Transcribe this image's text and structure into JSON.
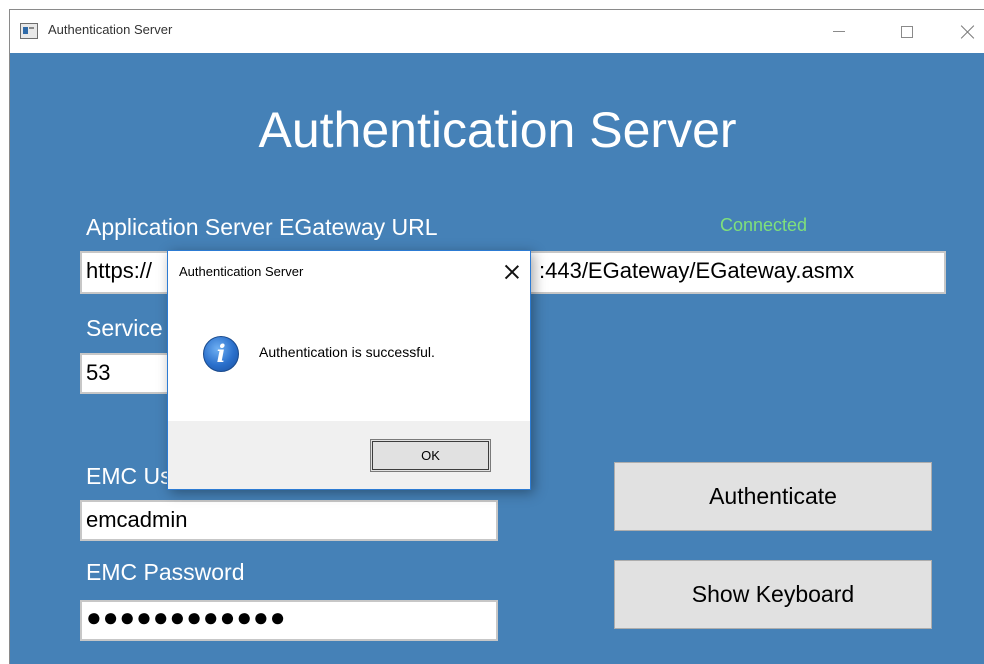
{
  "window": {
    "title": "Authentication Server",
    "controls": {
      "minimize": "minimize-icon",
      "maximize": "maximize-icon",
      "close": "close-icon"
    }
  },
  "main": {
    "heading": "Authentication Server",
    "url_label": "Application Server EGateway URL",
    "status": "Connected",
    "url_value": "https://",
    "url_value_suffix": ":443/EGateway/EGateway.asmx",
    "service_label": "Service",
    "service_value": "53",
    "user_label": "EMC Us",
    "user_value": "emcadmin",
    "password_label": "EMC Password",
    "password_value": "●●●●●●●●●●●●",
    "authenticate_button": "Authenticate",
    "keyboard_button": "Show Keyboard"
  },
  "dialog": {
    "title": "Authentication Server",
    "message": "Authentication is successful.",
    "icon": "info-icon",
    "ok_label": "OK"
  },
  "colors": {
    "background": "#4581b7",
    "status": "#7fe07b",
    "dialog_border": "#2c7bd3"
  }
}
